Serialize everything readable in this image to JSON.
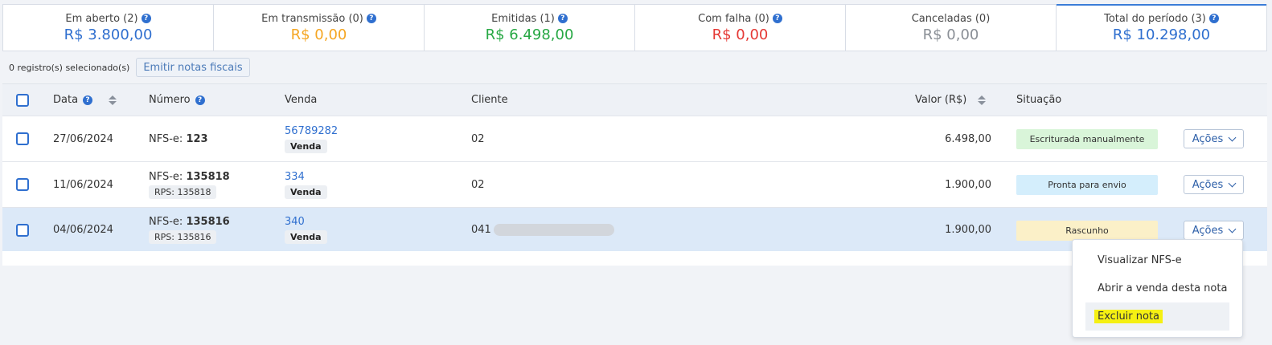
{
  "summary": [
    {
      "label": "Em aberto (2)",
      "value": "R$ 3.800,00",
      "color": "#2f6fcf",
      "help": true
    },
    {
      "label": "Em transmissão (0)",
      "value": "R$ 0,00",
      "color": "#f5a623",
      "help": true
    },
    {
      "label": "Emitidas (1)",
      "value": "R$ 6.498,00",
      "color": "#27a844",
      "help": true
    },
    {
      "label": "Com falha (0)",
      "value": "R$ 0,00",
      "color": "#e53935",
      "help": true
    },
    {
      "label": "Canceladas (0)",
      "value": "R$ 0,00",
      "color": "#8a8f96",
      "help": false
    },
    {
      "label": "Total do período (3)",
      "value": "R$ 10.298,00",
      "color": "#2f6fcf",
      "help": true
    }
  ],
  "toolbar": {
    "selected_count": "0 registro(s) selecionado(s)",
    "emit_label": "Emitir notas fiscais"
  },
  "table": {
    "headers": {
      "data": "Data",
      "numero": "Número",
      "venda": "Venda",
      "cliente": "Cliente",
      "valor": "Valor (R$)",
      "situacao": "Situação"
    },
    "rows": [
      {
        "date": "27/06/2024",
        "number_prefix": "NFS-e: ",
        "number": "123",
        "rps": "",
        "sale": "56789282",
        "sale_chip": "Venda",
        "client": "02",
        "value": "6.498,00",
        "status": "Escriturada manualmente",
        "status_bg": "#d9f5d9",
        "actions": "Ações"
      },
      {
        "date": "11/06/2024",
        "number_prefix": "NFS-e: ",
        "number": "135818",
        "rps": "RPS: 135818",
        "sale": "334",
        "sale_chip": "Venda",
        "client": "02",
        "value": "1.900,00",
        "status": "Pronta para envio",
        "status_bg": "#d4eefc",
        "actions": "Ações"
      },
      {
        "date": "04/06/2024",
        "number_prefix": "NFS-e: ",
        "number": "135816",
        "rps": "RPS: 135816",
        "sale": "340",
        "sale_chip": "Venda",
        "client": "041",
        "value": "1.900,00",
        "status": "Rascunho",
        "status_bg": "#fbf0c8",
        "actions": "Ações"
      }
    ]
  },
  "dropdown": {
    "items": [
      "Visualizar NFS-e",
      "Abrir a venda desta nota",
      "Excluir nota"
    ]
  }
}
